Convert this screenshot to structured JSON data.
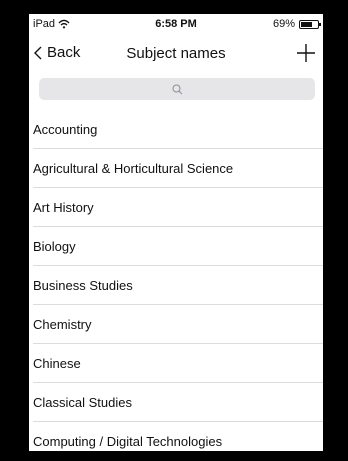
{
  "status_bar": {
    "carrier": "iPad",
    "time": "6:58 PM",
    "battery_text": "69%",
    "battery_level": 0.69
  },
  "nav": {
    "back_label": "Back",
    "title": "Subject names",
    "add_icon": "plus-icon"
  },
  "search": {
    "icon": "search-icon"
  },
  "subjects": [
    "Accounting",
    "Agricultural & Horticultural Science",
    "Art History",
    "Biology",
    "Business Studies",
    "Chemistry",
    "Chinese",
    "Classical Studies",
    "Computing / Digital Technologies"
  ]
}
